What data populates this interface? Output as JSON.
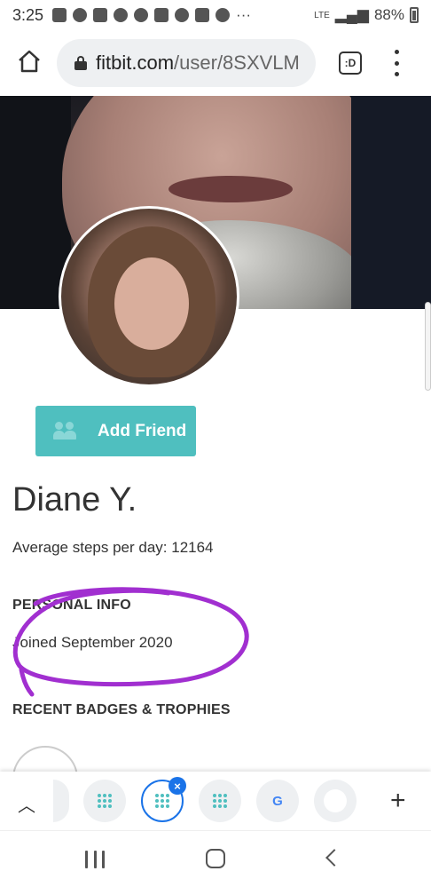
{
  "status_bar": {
    "time": "3:25",
    "network": "LTE",
    "battery": "88%"
  },
  "browser": {
    "url_host": "fitbit.com",
    "url_path": "/user/8SXVLM",
    "tab_count": ":D"
  },
  "profile": {
    "add_friend_label": "Add Friend",
    "name": "Diane Y.",
    "average_steps": "Average steps per day: 12164",
    "personal_info_title": "PERSONAL INFO",
    "joined": "Joined September 2020",
    "badges_title": "RECENT BADGES & TROPHIES"
  },
  "tab_strip": {
    "close_label": "×",
    "new_tab_label": "+",
    "google_label": "G"
  },
  "annotation": {
    "color": "#a12fd0"
  },
  "colors": {
    "accent": "#4fbfbf",
    "active_tab": "#1a73e8"
  }
}
